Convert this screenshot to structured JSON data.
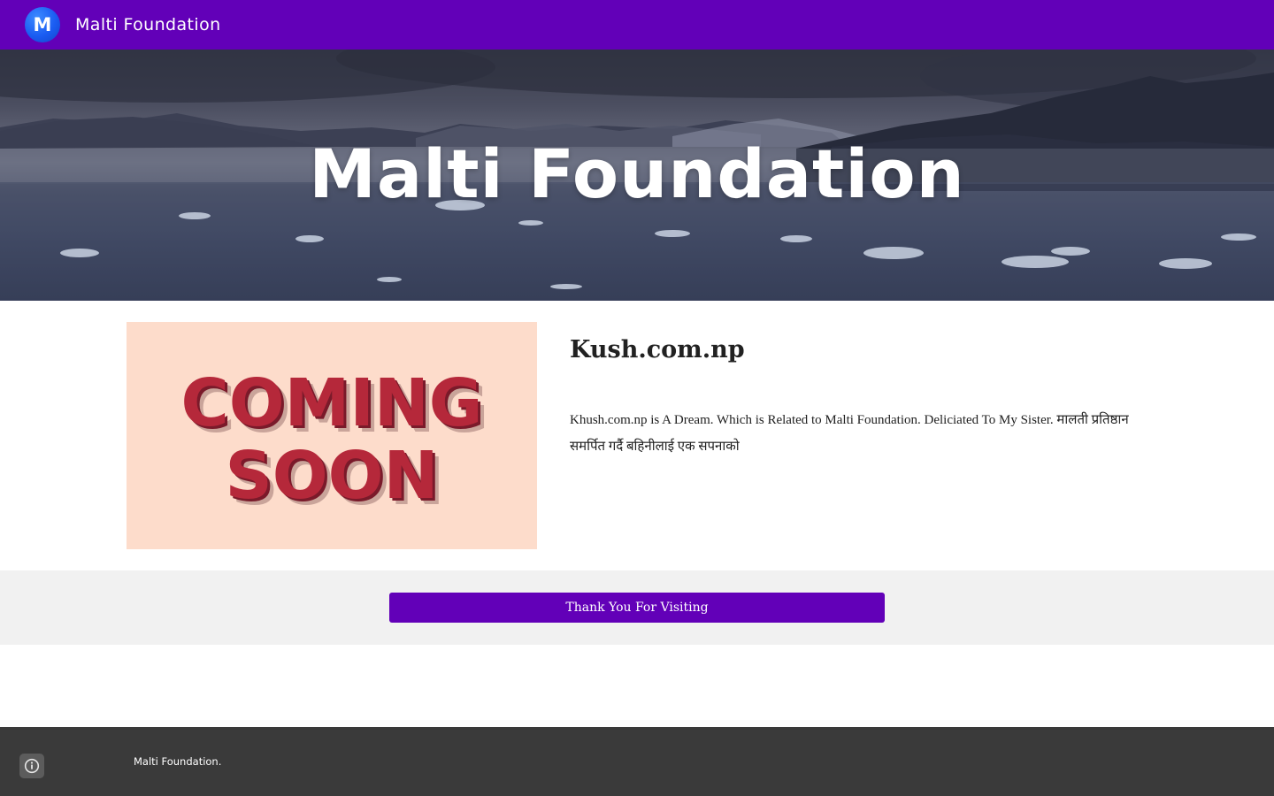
{
  "header": {
    "logo_letter": "M",
    "site_title": "Malti Foundation"
  },
  "hero": {
    "title": "Malti Foundation"
  },
  "content": {
    "image_text_line1": "COMING",
    "image_text_line2": "SOON",
    "heading": "Kush.com.np",
    "body": "Khush.com.np is A Dream. Which is Related to Malti Foundation. Deliciated To My Sister. मालती प्रतिष्ठान समर्पित गर्दै बहिनीलाई एक सपनाको"
  },
  "button_band": {
    "button_label": "Thank You For Visiting"
  },
  "footer": {
    "text": "Malti Foundation.",
    "info_icon": "info-icon"
  },
  "colors": {
    "brand_purple": "#6200b8",
    "logo_blue": "#1a5cf2",
    "footer_bg": "#3a3a3a",
    "band_bg": "#f1f1f1",
    "coming_soon_bg": "#fddccb",
    "coming_soon_text": "#b5283a"
  }
}
